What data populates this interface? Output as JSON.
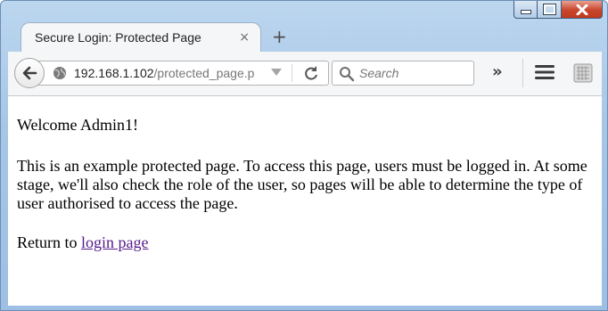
{
  "tab": {
    "title": "Secure Login: Protected Page",
    "close_glyph": "×",
    "new_tab_glyph": "+"
  },
  "urlbar": {
    "host": "192.168.1.102",
    "path": "/protected_page.p"
  },
  "search": {
    "placeholder": "Search"
  },
  "toolbar": {
    "overflow_glyph": "»"
  },
  "page": {
    "welcome": "Welcome Admin1!",
    "description": "This is an example protected page. To access this page, users must be logged in. At some stage, we'll also check the role of the user, so pages will be able to determine the type of user authorised to access the page.",
    "return_prefix": "Return to",
    "login_link": "login page"
  },
  "colors": {
    "link_visited": "#551a8b",
    "close_red": "#c9462c"
  },
  "icons": [
    "back-arrow-icon",
    "globe-icon",
    "dropdown-arrow-icon",
    "reload-icon",
    "search-icon",
    "hamburger-menu-icon",
    "extension-icon",
    "minimize-icon",
    "maximize-icon",
    "close-icon"
  ]
}
